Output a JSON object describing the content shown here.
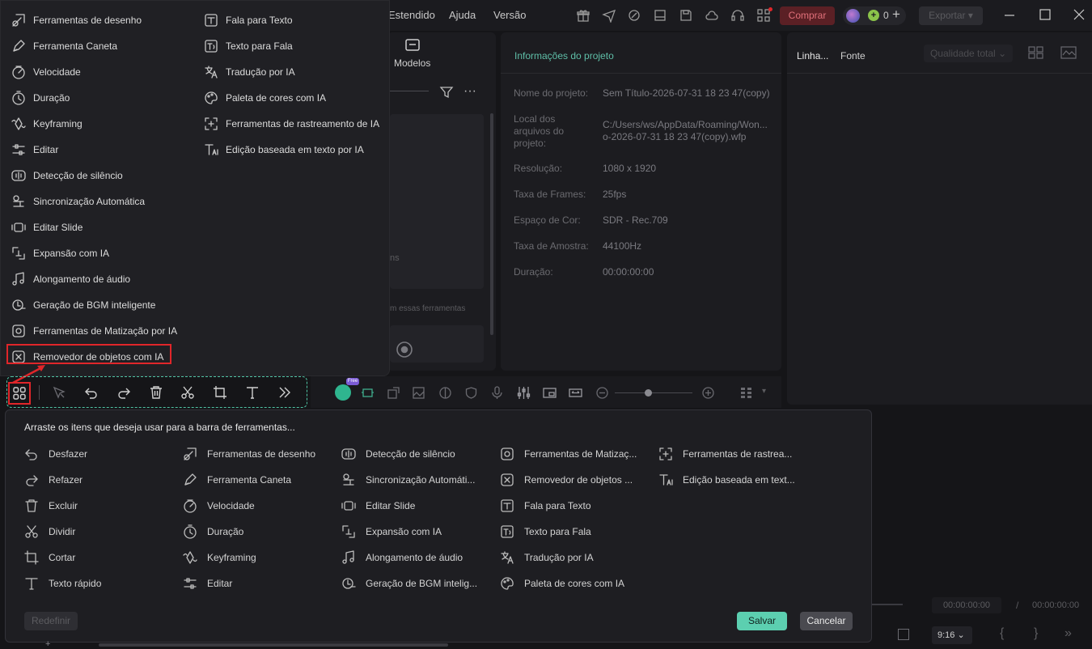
{
  "titlebar": {
    "menu": [
      "Estendido",
      "Ajuda",
      "Versão"
    ],
    "buy_label": "Comprar",
    "credits": "0",
    "export_label": "Exportar"
  },
  "media_panel": {
    "templates_label": "Modelos",
    "partial_text_1": "ns",
    "partial_text_2": "m essas ferramentas"
  },
  "project_info": {
    "title": "Informações do projeto",
    "rows": [
      {
        "label": "Nome do projeto:",
        "value": "Sem Título-2026-07-31 18 23 47(copy)"
      },
      {
        "label": "Local dos arquivos do projeto:",
        "value": "C:/Users/ws/AppData/Roaming/Wono-2026-07-31 18 23 47(copy).wfp"
      },
      {
        "label": "Resolução:",
        "value": "1080 x 1920"
      },
      {
        "label": "Taxa de Frames:",
        "value": "25fps"
      },
      {
        "label": "Espaço de Cor:",
        "value": "SDR - Rec.709"
      },
      {
        "label": "Taxa de Amostra:",
        "value": "44100Hz"
      },
      {
        "label": "Duração:",
        "value": "00:00:00:00"
      }
    ],
    "location_line1": "C:/Users/ws/AppData/Roaming/Won...",
    "location_line2": "o-2026-07-31 18 23 47(copy).wfp"
  },
  "right_panel": {
    "tab_line": "Linha...",
    "tab_font": "Fonte",
    "quality": "Qualidade total"
  },
  "player": {
    "time_current": "00:00:00:00",
    "separator": "/",
    "time_total": "00:00:00:00",
    "ratio": "9:16"
  },
  "popup_menu": {
    "col1": [
      {
        "label": "Ferramentas de desenho",
        "icon": "draw-icon"
      },
      {
        "label": "Ferramenta Caneta",
        "icon": "pen-icon"
      },
      {
        "label": "Velocidade",
        "icon": "speed-icon"
      },
      {
        "label": "Duração",
        "icon": "duration-icon"
      },
      {
        "label": "Keyframing",
        "icon": "keyframe-icon"
      },
      {
        "label": "Editar",
        "icon": "edit-sliders-icon"
      },
      {
        "label": "Detecção de silêncio",
        "icon": "silence-icon"
      },
      {
        "label": "Sincronização Automática",
        "icon": "sync-icon"
      },
      {
        "label": "Editar Slide",
        "icon": "slide-icon"
      },
      {
        "label": "Expansão com IA",
        "icon": "ai-expand-icon"
      },
      {
        "label": "Alongamento de áudio",
        "icon": "audio-stretch-icon"
      },
      {
        "label": "Geração de BGM inteligente",
        "icon": "bgm-icon"
      },
      {
        "label": "Ferramentas de Matização por IA",
        "icon": "ai-tint-icon"
      },
      {
        "label": "Removedor de objetos com IA",
        "icon": "object-remover-icon"
      }
    ],
    "col2": [
      {
        "label": "Fala para Texto",
        "icon": "speech-to-text-icon"
      },
      {
        "label": "Texto para Fala",
        "icon": "text-to-speech-icon"
      },
      {
        "label": "Tradução por IA",
        "icon": "translate-icon"
      },
      {
        "label": "Paleta de cores com IA",
        "icon": "palette-icon"
      },
      {
        "label": "Ferramentas de rastreamento de IA",
        "icon": "tracking-icon"
      },
      {
        "label": "Edição baseada em texto por IA",
        "icon": "text-edit-icon"
      }
    ]
  },
  "toolbar": {
    "free_badge": "Free"
  },
  "customize": {
    "title": "Arraste os itens que deseja usar para a barra de ferramentas...",
    "columns": [
      [
        {
          "label": "Desfazer",
          "icon": "undo-icon"
        },
        {
          "label": "Refazer",
          "icon": "redo-icon"
        },
        {
          "label": "Excluir",
          "icon": "trash-icon"
        },
        {
          "label": "Dividir",
          "icon": "scissors-icon"
        },
        {
          "label": "Cortar",
          "icon": "crop-icon"
        },
        {
          "label": "Texto rápido",
          "icon": "text-icon"
        }
      ],
      [
        {
          "label": "Ferramentas de desenho",
          "icon": "draw-icon"
        },
        {
          "label": "Ferramenta Caneta",
          "icon": "pen-icon"
        },
        {
          "label": "Velocidade",
          "icon": "speed-icon"
        },
        {
          "label": "Duração",
          "icon": "duration-icon"
        },
        {
          "label": "Keyframing",
          "icon": "keyframe-icon"
        },
        {
          "label": "Editar",
          "icon": "edit-sliders-icon"
        }
      ],
      [
        {
          "label": "Detecção de silêncio",
          "icon": "silence-icon"
        },
        {
          "label": "Sincronização Automáti...",
          "icon": "sync-icon"
        },
        {
          "label": "Editar Slide",
          "icon": "slide-icon"
        },
        {
          "label": "Expansão com IA",
          "icon": "ai-expand-icon"
        },
        {
          "label": "Alongamento de áudio",
          "icon": "audio-stretch-icon"
        },
        {
          "label": "Geração de BGM intelig...",
          "icon": "bgm-icon"
        }
      ],
      [
        {
          "label": "Ferramentas de Matizaç...",
          "icon": "ai-tint-icon"
        },
        {
          "label": "Removedor de objetos ...",
          "icon": "object-remover-icon"
        },
        {
          "label": "Fala para Texto",
          "icon": "speech-to-text-icon"
        },
        {
          "label": "Texto para Fala",
          "icon": "text-to-speech-icon"
        },
        {
          "label": "Tradução por IA",
          "icon": "translate-icon"
        },
        {
          "label": "Paleta de cores com IA",
          "icon": "palette-icon"
        }
      ],
      [
        {
          "label": "Ferramentas de rastrea...",
          "icon": "tracking-icon"
        },
        {
          "label": "Edição baseada em text...",
          "icon": "text-edit-icon"
        }
      ]
    ],
    "reset_label": "Redefinir",
    "save_label": "Salvar",
    "cancel_label": "Cancelar"
  },
  "colors": {
    "accent": "#5ccfb0",
    "highlight": "#e0262a",
    "buy": "#e0707a"
  }
}
